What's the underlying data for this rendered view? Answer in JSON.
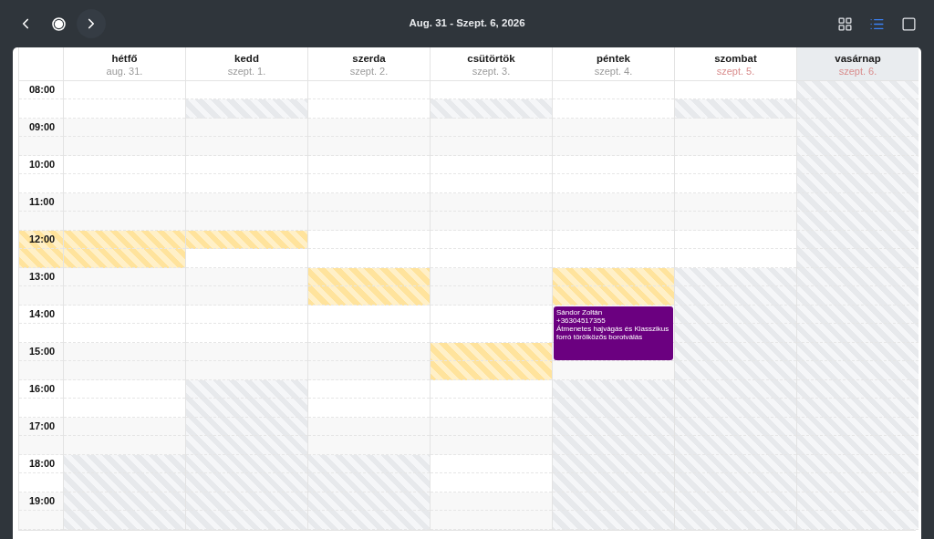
{
  "toolbar": {
    "title": "Aug. 31 - Szept. 6, 2026",
    "views": [
      {
        "kind": "grid",
        "selected": false
      },
      {
        "kind": "list",
        "selected": true
      },
      {
        "kind": "single",
        "selected": false
      }
    ]
  },
  "hours": [
    {
      "label": "08:00",
      "break": false
    },
    {
      "label": "09:00",
      "break": false
    },
    {
      "label": "10:00",
      "break": false
    },
    {
      "label": "11:00",
      "break": false
    },
    {
      "label": "12:00",
      "break": true
    },
    {
      "label": "13:00",
      "break": false
    },
    {
      "label": "14:00",
      "break": false
    },
    {
      "label": "15:00",
      "break": false
    },
    {
      "label": "16:00",
      "break": false
    },
    {
      "label": "17:00",
      "break": false
    },
    {
      "label": "18:00",
      "break": false
    },
    {
      "label": "19:00",
      "break": false
    }
  ],
  "days": [
    {
      "name": "hétfő",
      "date": "aug. 31.",
      "weekend": false,
      "today": false,
      "slots": [
        {
          "kind": "open"
        },
        {
          "kind": "open"
        },
        {
          "kind": "open"
        },
        {
          "kind": "open"
        },
        {
          "kind": "open"
        },
        {
          "kind": "open"
        },
        {
          "kind": "open"
        },
        {
          "kind": "open"
        },
        {
          "kind": "break"
        },
        {
          "kind": "break"
        },
        {
          "kind": "open"
        },
        {
          "kind": "open"
        },
        {
          "kind": "open"
        },
        {
          "kind": "open"
        },
        {
          "kind": "open"
        },
        {
          "kind": "open"
        },
        {
          "kind": "open"
        },
        {
          "kind": "open"
        },
        {
          "kind": "open"
        },
        {
          "kind": "open"
        },
        {
          "kind": "closed"
        },
        {
          "kind": "closed"
        },
        {
          "kind": "closed"
        },
        {
          "kind": "closed"
        }
      ]
    },
    {
      "name": "kedd",
      "date": "szept. 1.",
      "weekend": false,
      "today": false,
      "slots": [
        {
          "kind": "open"
        },
        {
          "kind": "closed"
        },
        {
          "kind": "open"
        },
        {
          "kind": "open"
        },
        {
          "kind": "open"
        },
        {
          "kind": "open"
        },
        {
          "kind": "open"
        },
        {
          "kind": "open"
        },
        {
          "kind": "break"
        },
        {
          "kind": "open"
        },
        {
          "kind": "open"
        },
        {
          "kind": "open"
        },
        {
          "kind": "open"
        },
        {
          "kind": "open"
        },
        {
          "kind": "open"
        },
        {
          "kind": "open"
        },
        {
          "kind": "closed"
        },
        {
          "kind": "closed"
        },
        {
          "kind": "closed"
        },
        {
          "kind": "closed"
        },
        {
          "kind": "closed"
        },
        {
          "kind": "closed"
        },
        {
          "kind": "closed"
        },
        {
          "kind": "closed"
        }
      ]
    },
    {
      "name": "szerda",
      "date": "szept. 2.",
      "weekend": false,
      "today": false,
      "slots": [
        {
          "kind": "open"
        },
        {
          "kind": "open"
        },
        {
          "kind": "open"
        },
        {
          "kind": "open"
        },
        {
          "kind": "open"
        },
        {
          "kind": "open"
        },
        {
          "kind": "open"
        },
        {
          "kind": "open"
        },
        {
          "kind": "open"
        },
        {
          "kind": "open"
        },
        {
          "kind": "break"
        },
        {
          "kind": "break"
        },
        {
          "kind": "open"
        },
        {
          "kind": "open"
        },
        {
          "kind": "open"
        },
        {
          "kind": "open"
        },
        {
          "kind": "open"
        },
        {
          "kind": "open"
        },
        {
          "kind": "open"
        },
        {
          "kind": "open"
        },
        {
          "kind": "closed"
        },
        {
          "kind": "closed"
        },
        {
          "kind": "closed"
        },
        {
          "kind": "closed"
        }
      ]
    },
    {
      "name": "csütörtök",
      "date": "szept. 3.",
      "weekend": false,
      "today": false,
      "slots": [
        {
          "kind": "open"
        },
        {
          "kind": "closed"
        },
        {
          "kind": "open"
        },
        {
          "kind": "open"
        },
        {
          "kind": "open"
        },
        {
          "kind": "open"
        },
        {
          "kind": "open"
        },
        {
          "kind": "open"
        },
        {
          "kind": "open"
        },
        {
          "kind": "open"
        },
        {
          "kind": "open"
        },
        {
          "kind": "open"
        },
        {
          "kind": "open"
        },
        {
          "kind": "open"
        },
        {
          "kind": "break"
        },
        {
          "kind": "break"
        },
        {
          "kind": "open"
        },
        {
          "kind": "open"
        },
        {
          "kind": "open"
        },
        {
          "kind": "open"
        },
        {
          "kind": "open"
        },
        {
          "kind": "open"
        },
        {
          "kind": "open"
        },
        {
          "kind": "open"
        }
      ]
    },
    {
      "name": "péntek",
      "date": "szept. 4.",
      "weekend": false,
      "today": false,
      "slots": [
        {
          "kind": "open"
        },
        {
          "kind": "open"
        },
        {
          "kind": "open"
        },
        {
          "kind": "open"
        },
        {
          "kind": "open"
        },
        {
          "kind": "open"
        },
        {
          "kind": "open"
        },
        {
          "kind": "open"
        },
        {
          "kind": "open"
        },
        {
          "kind": "open"
        },
        {
          "kind": "break"
        },
        {
          "kind": "break"
        },
        {
          "kind": "booked"
        },
        {
          "kind": "booked"
        },
        {
          "kind": "booked"
        },
        {
          "kind": "open"
        },
        {
          "kind": "closed"
        },
        {
          "kind": "closed"
        },
        {
          "kind": "closed"
        },
        {
          "kind": "closed"
        },
        {
          "kind": "closed"
        },
        {
          "kind": "closed"
        },
        {
          "kind": "closed"
        },
        {
          "kind": "closed"
        }
      ],
      "appointments": [
        {
          "name": "Sándor Zoltán",
          "phone": "+36304517355",
          "service": "Átmenetes hajvágás és Klasszikus forró törölközős borotválás"
        }
      ]
    },
    {
      "name": "szombat",
      "date": "szept. 5.",
      "weekend": true,
      "today": false,
      "slots": [
        {
          "kind": "open"
        },
        {
          "kind": "closed"
        },
        {
          "kind": "open"
        },
        {
          "kind": "open"
        },
        {
          "kind": "open"
        },
        {
          "kind": "open"
        },
        {
          "kind": "open"
        },
        {
          "kind": "open"
        },
        {
          "kind": "open"
        },
        {
          "kind": "open"
        },
        {
          "kind": "closed"
        },
        {
          "kind": "closed"
        },
        {
          "kind": "closed"
        },
        {
          "kind": "closed"
        },
        {
          "kind": "closed"
        },
        {
          "kind": "closed"
        },
        {
          "kind": "closed"
        },
        {
          "kind": "closed"
        },
        {
          "kind": "closed"
        },
        {
          "kind": "closed"
        },
        {
          "kind": "closed"
        },
        {
          "kind": "closed"
        },
        {
          "kind": "closed"
        },
        {
          "kind": "closed"
        }
      ]
    },
    {
      "name": "vasárnap",
      "date": "szept. 6.",
      "weekend": true,
      "today": true,
      "slots": [
        {
          "kind": "closed"
        },
        {
          "kind": "closed"
        },
        {
          "kind": "closed"
        },
        {
          "kind": "closed"
        },
        {
          "kind": "closed"
        },
        {
          "kind": "closed"
        },
        {
          "kind": "closed"
        },
        {
          "kind": "closed"
        },
        {
          "kind": "closed"
        },
        {
          "kind": "closed"
        },
        {
          "kind": "closed"
        },
        {
          "kind": "closed"
        },
        {
          "kind": "closed"
        },
        {
          "kind": "closed"
        },
        {
          "kind": "closed"
        },
        {
          "kind": "closed"
        },
        {
          "kind": "closed"
        },
        {
          "kind": "closed"
        },
        {
          "kind": "closed"
        },
        {
          "kind": "closed"
        },
        {
          "kind": "closed"
        },
        {
          "kind": "closed"
        },
        {
          "kind": "closed"
        },
        {
          "kind": "closed"
        }
      ]
    }
  ]
}
